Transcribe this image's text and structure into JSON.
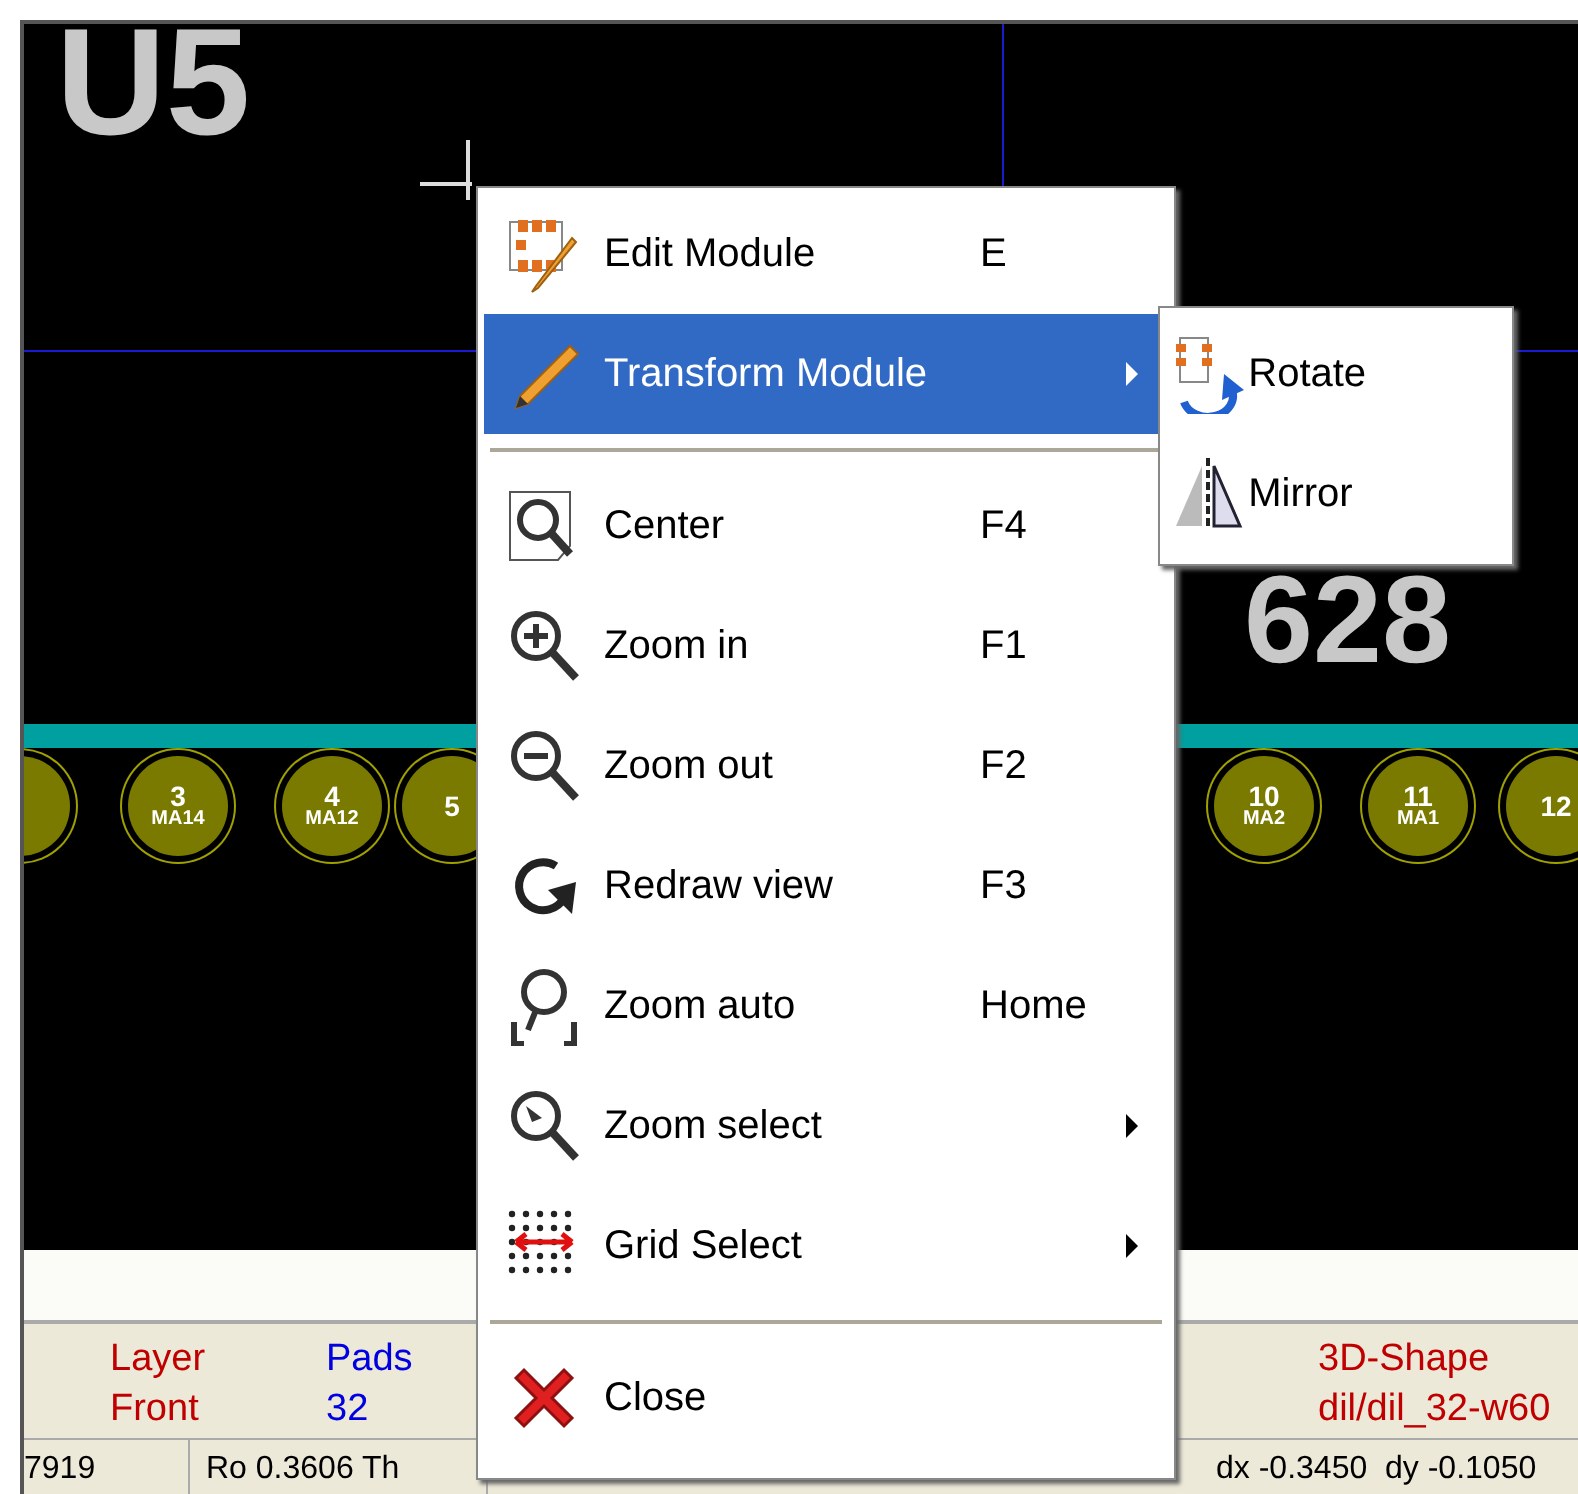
{
  "canvas": {
    "reference_label": "U5",
    "value_label": "628",
    "pads": [
      {
        "number": "3",
        "name": "MA14"
      },
      {
        "number": "4",
        "name": "MA12"
      },
      {
        "number": "5"
      },
      {
        "number": "10",
        "name": "MA2"
      },
      {
        "number": "11",
        "name": "MA1"
      },
      {
        "number": "12"
      }
    ]
  },
  "info_panel": [
    {
      "label": "Layer",
      "value": "Front",
      "color": "#c00000"
    },
    {
      "label": "Pads",
      "value": "32",
      "color": "#0000e0"
    },
    {
      "label": "3D-Shape",
      "value": "dil/dil_32-w60",
      "color": "#c00000"
    }
  ],
  "status_bar": [
    "7919",
    "Ro 0.3606 Th",
    "dx -0.3450  dy -0.1050"
  ],
  "context_menu": [
    {
      "kind": "item",
      "label": "Edit Module",
      "shortcut": "E",
      "submenu": false,
      "selected": false
    },
    {
      "kind": "item",
      "label": "Transform Module",
      "submenu": true,
      "selected": true
    },
    {
      "kind": "separator"
    },
    {
      "kind": "item",
      "label": "Center",
      "shortcut": "F4",
      "submenu": false,
      "selected": false
    },
    {
      "kind": "item",
      "label": "Zoom in",
      "shortcut": "F1",
      "submenu": false,
      "selected": false
    },
    {
      "kind": "item",
      "label": "Zoom out",
      "shortcut": "F2",
      "submenu": false,
      "selected": false
    },
    {
      "kind": "item",
      "label": "Redraw view",
      "shortcut": "F3",
      "submenu": false,
      "selected": false
    },
    {
      "kind": "item",
      "label": "Zoom auto",
      "shortcut": "Home",
      "submenu": false,
      "selected": false
    },
    {
      "kind": "item",
      "label": "Zoom select",
      "submenu": true,
      "selected": false
    },
    {
      "kind": "item",
      "label": "Grid Select",
      "submenu": true,
      "selected": false
    },
    {
      "kind": "separator"
    },
    {
      "kind": "item",
      "label": "Close",
      "submenu": false,
      "selected": false
    }
  ],
  "submenu": [
    {
      "label": "Rotate"
    },
    {
      "label": "Mirror"
    }
  ]
}
